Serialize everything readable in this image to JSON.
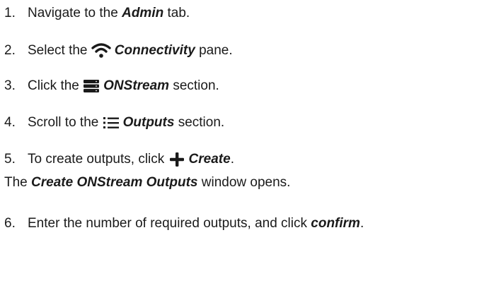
{
  "steps": [
    {
      "number": "1.",
      "before": "Navigate to the ",
      "emphasis": "Admin",
      "after": " tab."
    },
    {
      "number": "2.",
      "before": "Select the ",
      "icon": "wifi-icon",
      "emphasis": "Connectivity",
      "after": " pane."
    },
    {
      "number": "3.",
      "before": "Click the ",
      "icon": "server-stack-icon",
      "emphasis": "ONStream",
      "after": " section."
    },
    {
      "number": "4.",
      "before": "Scroll to the ",
      "icon": "list-icon",
      "emphasis": "Outputs",
      "after": " section."
    },
    {
      "number": "5.",
      "before": "To create outputs, click ",
      "icon": "plus-icon",
      "emphasis": "Create",
      "after": "."
    },
    {
      "number": "6.",
      "before": "Enter the number of required outputs, and click ",
      "emphasis": "confirm",
      "after": "."
    }
  ],
  "note": {
    "before": "The ",
    "emphasis": "Create ONStream Outputs",
    "after": " window opens."
  }
}
